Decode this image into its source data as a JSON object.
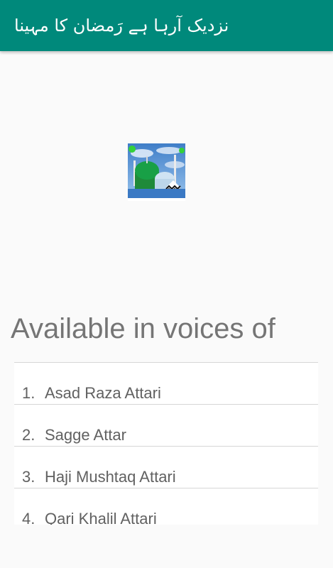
{
  "app_bar": {
    "title": "نزدیک آرہا ہے رَمضان کا مہینا",
    "color": "#00897b"
  },
  "image": {
    "description_icon": "madina-green-dome-image"
  },
  "heading": "Available in voices of",
  "voices": [
    {
      "number": "1.",
      "name": "Asad Raza Attari"
    },
    {
      "number": "2.",
      "name": "Sagge Attar"
    },
    {
      "number": "3.",
      "name": "Haji Mushtaq Attari"
    },
    {
      "number": "4.",
      "name": "Qari Khalil Attari"
    }
  ]
}
